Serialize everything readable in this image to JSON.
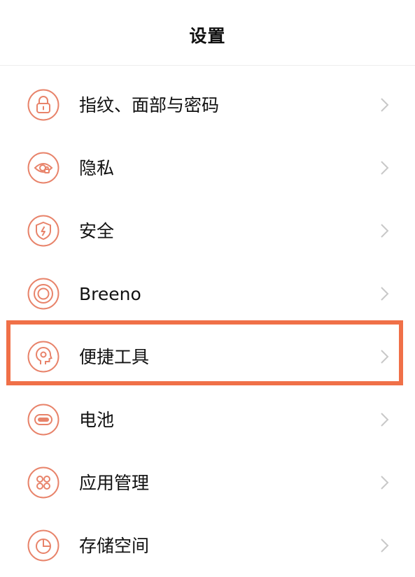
{
  "header": {
    "title": "设置"
  },
  "colors": {
    "accent": "#e8836a",
    "highlight": "#f07048",
    "chevron": "#c8c8c8"
  },
  "settings": {
    "items": [
      {
        "label": "指纹、面部与密码",
        "icon": "lock-icon"
      },
      {
        "label": "隐私",
        "icon": "privacy-eye-icon"
      },
      {
        "label": "安全",
        "icon": "shield-icon"
      },
      {
        "label": "Breeno",
        "icon": "breeno-icon"
      },
      {
        "label": "便捷工具",
        "icon": "head-gear-icon"
      },
      {
        "label": "电池",
        "icon": "battery-icon"
      },
      {
        "label": "应用管理",
        "icon": "apps-icon"
      },
      {
        "label": "存储空间",
        "icon": "storage-pie-icon"
      }
    ],
    "highlighted_item": "便捷工具"
  }
}
